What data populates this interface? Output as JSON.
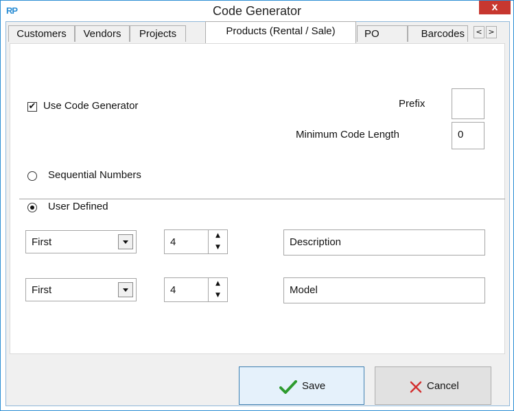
{
  "window": {
    "app_icon": "RP",
    "title": "Code Generator",
    "close": "x"
  },
  "tabs": {
    "items": [
      {
        "label": "Customers"
      },
      {
        "label": "Vendors"
      },
      {
        "label": "Projects"
      },
      {
        "label": "Products (Rental / Sale)"
      },
      {
        "label": "PO"
      },
      {
        "label": "Barcodes"
      }
    ],
    "active": "Products (Rental / Sale)",
    "scroll_left": "<",
    "scroll_right": ">"
  },
  "settings": {
    "use_code_generator": {
      "label": "Use Code Generator",
      "checked": true
    },
    "prefix": {
      "label": "Prefix",
      "value": ""
    },
    "min_length": {
      "label": "Minimum Code Length",
      "value": "0"
    }
  },
  "mode": {
    "sequential": {
      "label": "Sequential Numbers",
      "selected": false
    },
    "user_defined": {
      "label": "User Defined",
      "selected": true
    }
  },
  "rules": [
    {
      "position": "First",
      "count": "4",
      "field": "Description"
    },
    {
      "position": "First",
      "count": "4",
      "field": "Model"
    }
  ],
  "buttons": {
    "save": "Save",
    "cancel": "Cancel"
  },
  "colors": {
    "accent": "#2a8dd4",
    "close": "#c7372f",
    "save_icon": "#2e9b2e",
    "cancel_icon": "#d32f2f"
  }
}
